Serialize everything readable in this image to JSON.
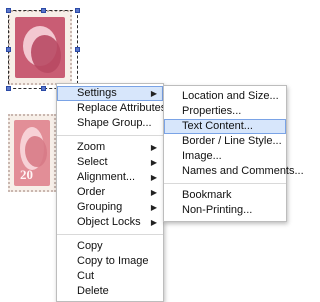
{
  "main_menu": {
    "items": [
      {
        "label": "Settings",
        "has_submenu": true,
        "state": "active"
      },
      {
        "label": "Replace Attributes...",
        "has_submenu": false
      },
      {
        "label": "Shape Group...",
        "has_submenu": false
      },
      {
        "label": "Zoom",
        "has_submenu": true
      },
      {
        "label": "Select",
        "has_submenu": true
      },
      {
        "label": "Alignment...",
        "has_submenu": true
      },
      {
        "label": "Order",
        "has_submenu": true
      },
      {
        "label": "Grouping",
        "has_submenu": true
      },
      {
        "label": "Object Locks",
        "has_submenu": true
      },
      {
        "label": "Copy",
        "has_submenu": false
      },
      {
        "label": "Copy to Image",
        "has_submenu": false
      },
      {
        "label": "Cut",
        "has_submenu": false
      },
      {
        "label": "Delete",
        "has_submenu": false
      }
    ]
  },
  "settings_submenu": {
    "items": [
      {
        "label": "Location and Size..."
      },
      {
        "label": "Properties..."
      },
      {
        "label": "Text Content...",
        "state": "highlighted"
      },
      {
        "label": "Border / Line Style..."
      },
      {
        "label": "Image..."
      },
      {
        "label": "Names and Comments..."
      },
      {
        "label": "Bookmark"
      },
      {
        "label": "Non-Printing..."
      }
    ]
  },
  "canvas": {
    "stamps": [
      {
        "value": ""
      },
      {
        "value": "20"
      }
    ]
  },
  "colors": {
    "highlight_bg": "#d7e6fb",
    "highlight_border": "#7aa3e6",
    "handle": "#5b76c9",
    "stamp_red": "#c95d74",
    "stamp_pink": "#e28e97"
  },
  "icons": {
    "submenu_arrow": "▶"
  }
}
